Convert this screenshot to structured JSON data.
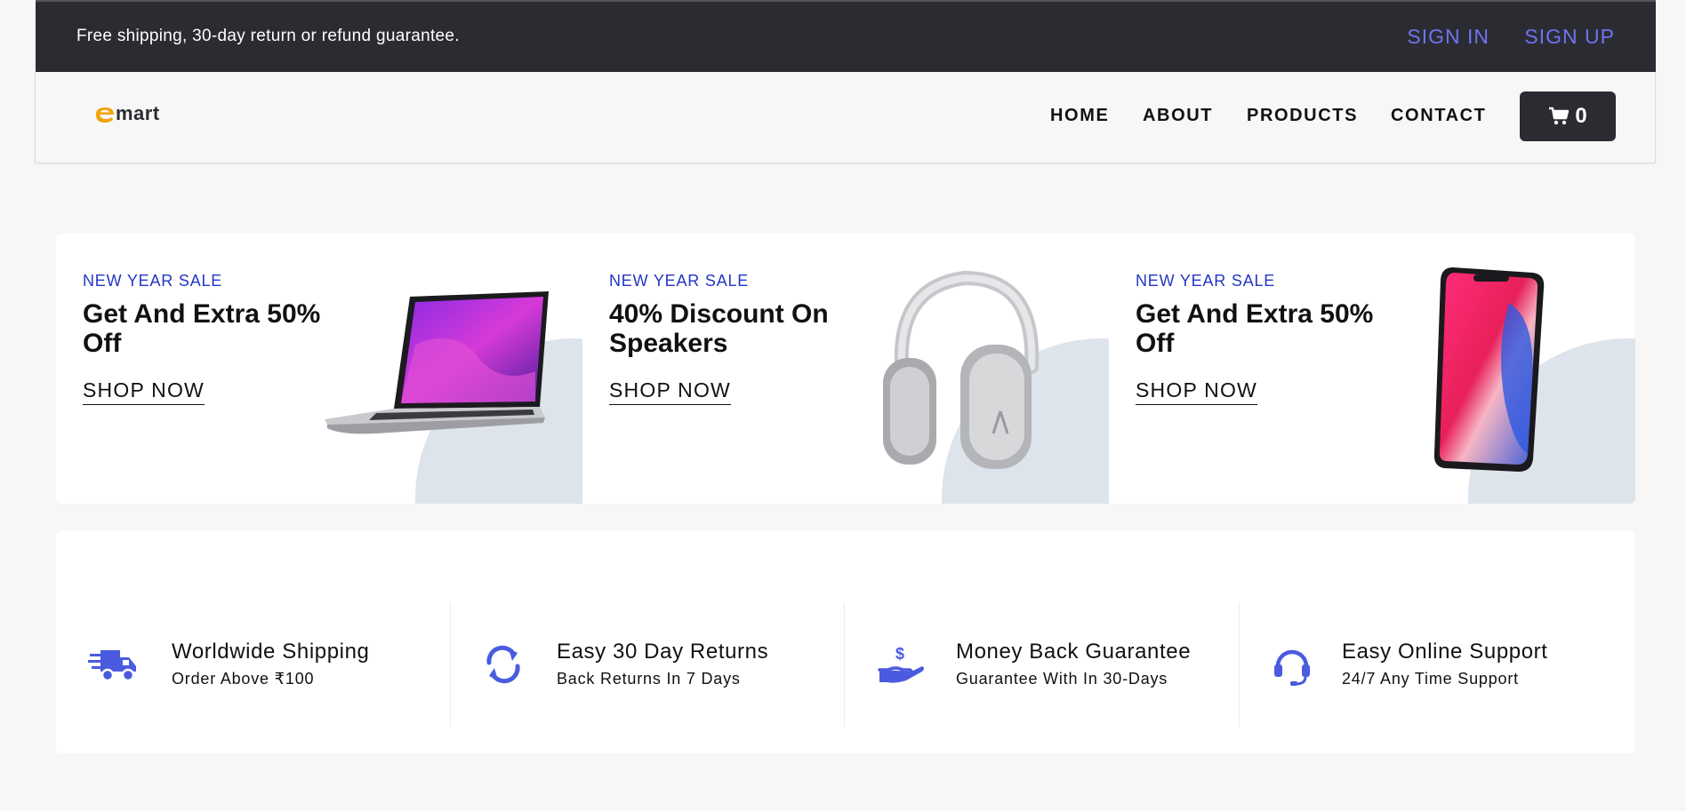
{
  "topbar": {
    "promo_text": "Free shipping, 30-day return or refund guarantee.",
    "sign_in": "SIGN IN",
    "sign_up": "SIGN UP",
    "link_color": "#6f73f2"
  },
  "nav": {
    "logo_text": "emart",
    "links": [
      "HOME",
      "ABOUT",
      "PRODUCTS",
      "CONTACT"
    ],
    "cart_icon": "shopping-cart-icon",
    "cart_count": "0"
  },
  "promos": [
    {
      "tag": "NEW YEAR SALE",
      "headline": "Get And Extra 50% Off",
      "cta": "SHOP NOW",
      "image": "laptop"
    },
    {
      "tag": "NEW YEAR SALE",
      "headline": "40% Discount On Speakers",
      "cta": "SHOP NOW",
      "image": "headphones"
    },
    {
      "tag": "NEW YEAR SALE",
      "headline": "Get And Extra 50% Off",
      "cta": "SHOP NOW",
      "image": "smartphone"
    }
  ],
  "features": [
    {
      "icon": "shipping-truck-icon",
      "title": "Worldwide Shipping",
      "subtitle": "Order Above ₹100"
    },
    {
      "icon": "refresh-icon",
      "title": "Easy 30 Day Returns",
      "subtitle": "Back Returns In 7 Days"
    },
    {
      "icon": "money-hand-icon",
      "title": "Money Back Guarantee",
      "subtitle": "Guarantee With In 30-Days"
    },
    {
      "icon": "headset-icon",
      "title": "Easy Online Support",
      "subtitle": "24/7 Any Time Support"
    }
  ],
  "colors": {
    "dark": "#2b2c31",
    "accent_blue": "#2436c4",
    "icon_blue": "#4a5be0"
  }
}
